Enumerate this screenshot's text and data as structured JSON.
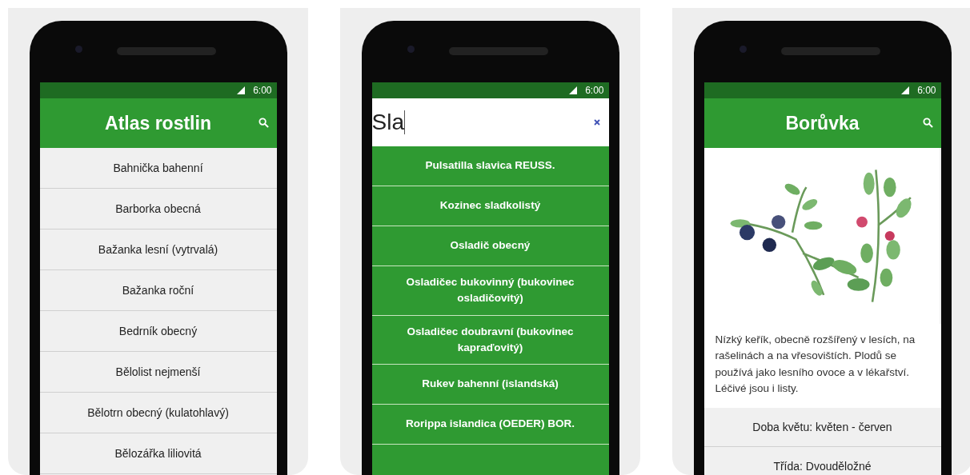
{
  "screens": [
    {
      "kind": "list",
      "status_time": "6:00",
      "title": "Atlas rostlin",
      "items": [
        "Bahnička bahenní",
        "Barborka obecná",
        "Bažanka lesní (vytrvalá)",
        "Bažanka roční",
        "Bedrník obecný",
        "Bělolist nejmenší",
        "Bělotrn obecný (kulatohlavý)",
        "Bělozářka liliovitá"
      ]
    },
    {
      "kind": "search",
      "status_time": "6:00",
      "search": {
        "value": "Sla"
      },
      "results": [
        "Pulsatilla slavica REUSS.",
        "Kozinec sladkolistý",
        "Osladič obecný",
        "Osladičec bukovinný (bukovinec osladičovitý)",
        "Osladičec doubravní (bukovinec kapraďovitý)",
        "Rukev bahenní (islandská)",
        "Rorippa islandica (OEDER) BOR."
      ]
    },
    {
      "kind": "detail",
      "status_time": "6:00",
      "title": "Borůvka",
      "description": "Nízký keřík, obecně rozšířený v lesích, na rašelinách a na vřesovištích. Plodů se používá jako lesního ovoce a v lékařství. Léčivé jsou i listy.",
      "facts": [
        "Doba květu: květen - červen",
        "Třída: Dvouděložné"
      ]
    }
  ]
}
